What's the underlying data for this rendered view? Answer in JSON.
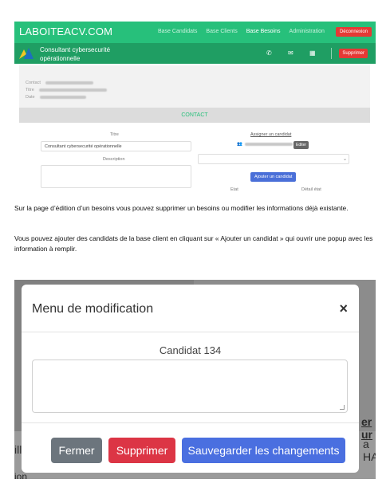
{
  "screenshot1": {
    "brand": "LABOITEACV.COM",
    "nav": [
      "Base Candidats",
      "Base Clients",
      "Base Besoins",
      "Administration"
    ],
    "nav_active_index": 2,
    "logout_label": "Déconnexion",
    "page_title": "Consultant cybersecurité opérationnelle",
    "delete_label": "Supprimer",
    "card_rows": [
      "Contact",
      "Titre",
      "Date"
    ],
    "contact_label": "CONTACT",
    "titre_label": "Titre",
    "titre_value": "Consultant cybersecurité opérationnelle",
    "description_label": "Description",
    "assign_label": "Assigner un candidat",
    "edit_label": "Editer",
    "add_candidate_label": "Ajouter un candidat",
    "etat_label": "Etat",
    "detail_etat_label": "Détail état",
    "colors": {
      "green": "#27c07b",
      "dark_green": "#1f9e63",
      "red": "#e53935",
      "blue": "#4a6fd8"
    }
  },
  "paragraph1": "Sur la page d’édition d’un besoins vous pouvez supprimer un besoins ou modifier les informations déjà existante.",
  "paragraph2": "Vous pouvez ajouter des candidats de la base client en cliquant sur « Ajouter un candidat » qui ouvrir une popup avec les information à remplir.",
  "modal": {
    "title": "Menu de modification",
    "close_icon": "×",
    "candidate_label": "Candidat 134",
    "buttons": {
      "close": "Fermer",
      "delete": "Supprimer",
      "save": "Sauvegarder les changements"
    },
    "colors": {
      "close": "#6c757d",
      "delete": "#dc3545",
      "save": "#4a6fe0"
    }
  },
  "background_fragments": [
    "er ur",
    "a HA",
    "ill",
    "ion"
  ]
}
